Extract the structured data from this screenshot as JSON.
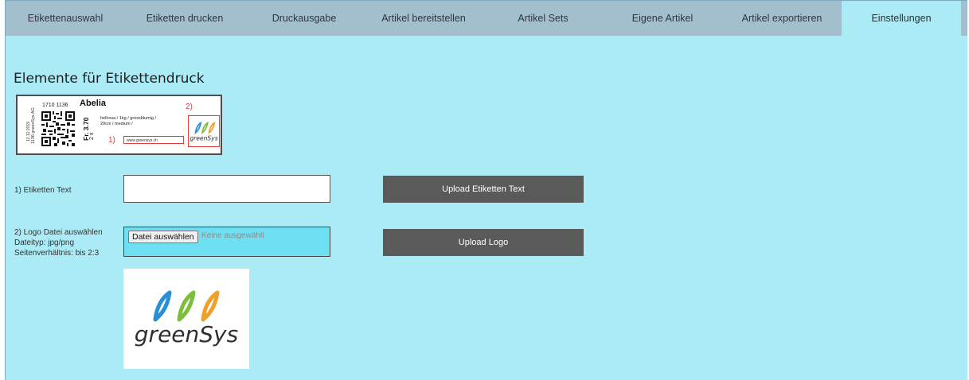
{
  "nav": {
    "tabs": [
      {
        "label": "Etikettenauswahl"
      },
      {
        "label": "Etiketten drucken"
      },
      {
        "label": "Druckausgabe"
      },
      {
        "label": "Artikel bereitstellen"
      },
      {
        "label": "Artikel Sets"
      },
      {
        "label": "Eigene Artikel"
      },
      {
        "label": "Artikel exportieren"
      },
      {
        "label": "Einstellungen"
      }
    ],
    "active_tab": "Einstellungen"
  },
  "section": {
    "title": "Elemente für Etikettendruck"
  },
  "label_sample": {
    "date": "12.12.2019",
    "company": "1136 greenSys AG",
    "article_number": "1710 1136",
    "name": "Abelia",
    "description": "hellrosa / 1kg / grossblumig / 20cm / medium /",
    "price": "Fr. 3.70",
    "quantity": "2 x",
    "url": "www.greensys.ch",
    "marker_text": "1)",
    "marker_logo": "2)",
    "logo_text": "greenSys"
  },
  "form": {
    "text_label": "1) Etiketten Text",
    "text_value": "",
    "logo_label_line1": "2) Logo Datei auswählen",
    "logo_label_line2": "Dateityp: jpg/png",
    "logo_label_line3": "Seitenverhältnis: bis 2:3",
    "file_button": "Datei auswählen",
    "file_status": "Keine ausgewählt",
    "upload_text_button": "Upload Etiketten Text",
    "upload_logo_button": "Upload Logo"
  },
  "logo_preview": {
    "text": "greenSys"
  },
  "colors": {
    "background": "#abebf5",
    "tabbar": "#a3bfce",
    "button": "#5a5a5a",
    "marker": "#e23b3b",
    "leaf_blue": "#2a8fd6",
    "leaf_green": "#7bbf3a",
    "leaf_orange": "#f0a02a"
  }
}
